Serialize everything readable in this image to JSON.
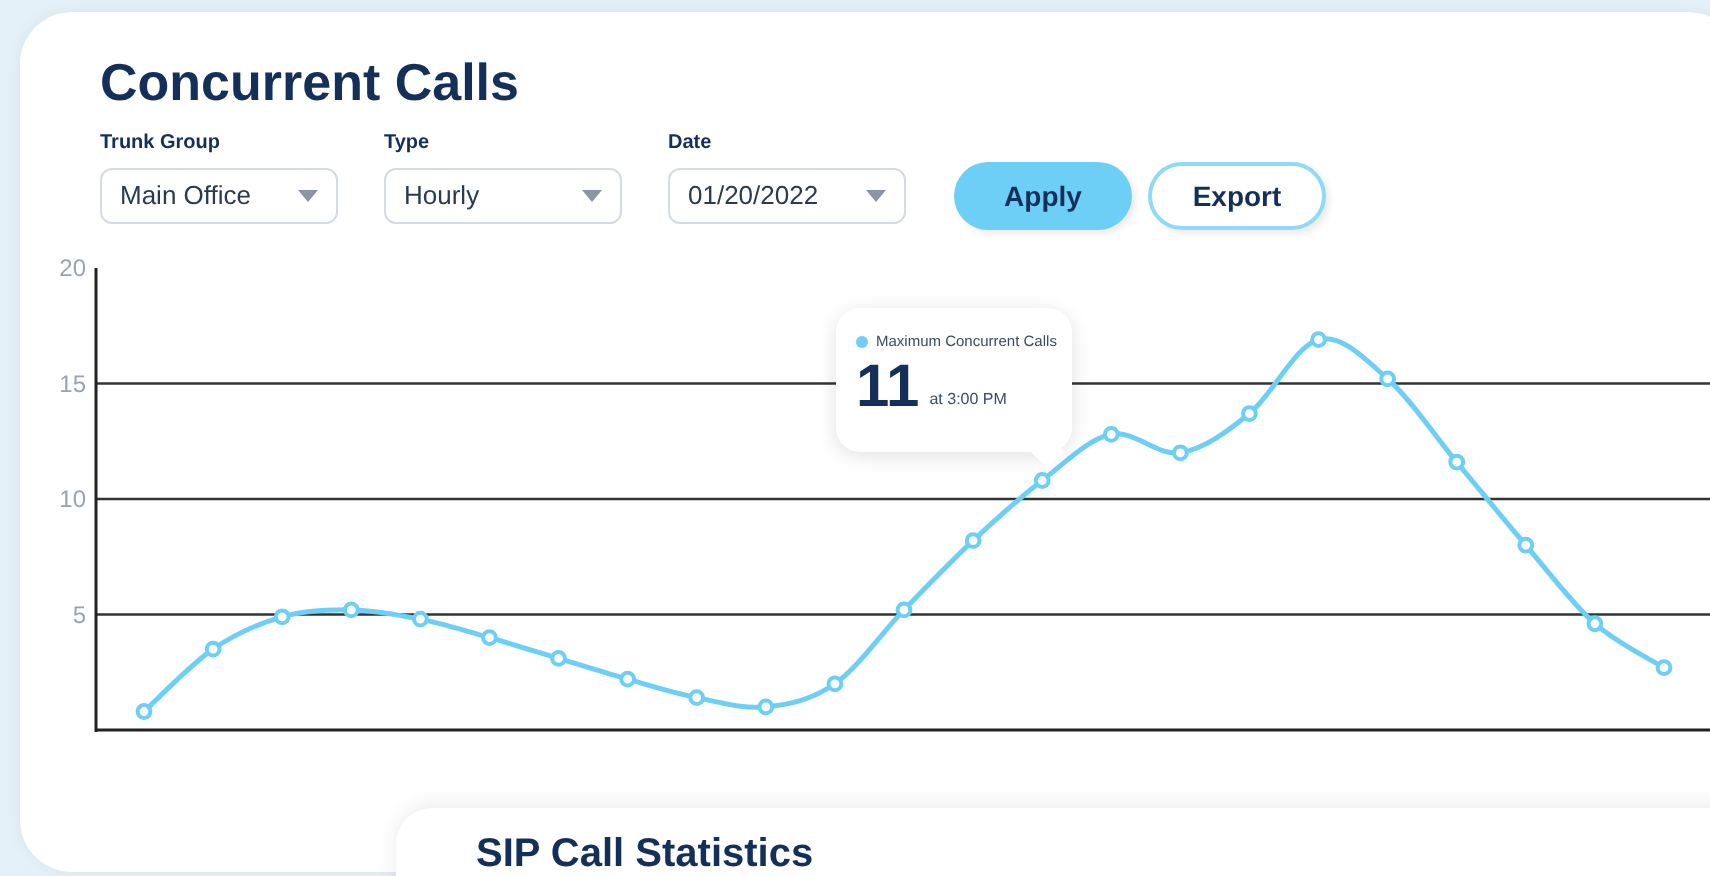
{
  "title": "Concurrent Calls",
  "filters": [
    {
      "label": "Trunk Group",
      "value": "Main Office"
    },
    {
      "label": "Type",
      "value": "Hourly"
    },
    {
      "label": "Date",
      "value": "01/20/2022"
    }
  ],
  "buttons": [
    {
      "label": "Apply",
      "kind": "primary"
    },
    {
      "label": "Export",
      "kind": "secondary"
    }
  ],
  "chart": {
    "chart_data": {
      "type": "line",
      "ylim": [
        0,
        20
      ],
      "yticks": [
        5,
        10,
        15,
        20
      ],
      "grid": true,
      "series": [
        {
          "name": "Maximum Concurrent Calls",
          "color": "#6dcff6",
          "marker": true,
          "values": [
            0.8,
            3.5,
            4.9,
            5.2,
            4.8,
            4.0,
            3.1,
            2.2,
            1.4,
            1.0,
            2.0,
            5.2,
            8.2,
            10.8,
            12.8,
            12.0,
            13.7,
            16.9,
            15.2,
            11.6,
            8.0,
            4.6,
            2.7
          ]
        }
      ]
    },
    "tooltip": {
      "value": "11",
      "time": "at 3:00 PM"
    }
  },
  "next_card": {
    "title": "SIP Call Statistics"
  }
}
